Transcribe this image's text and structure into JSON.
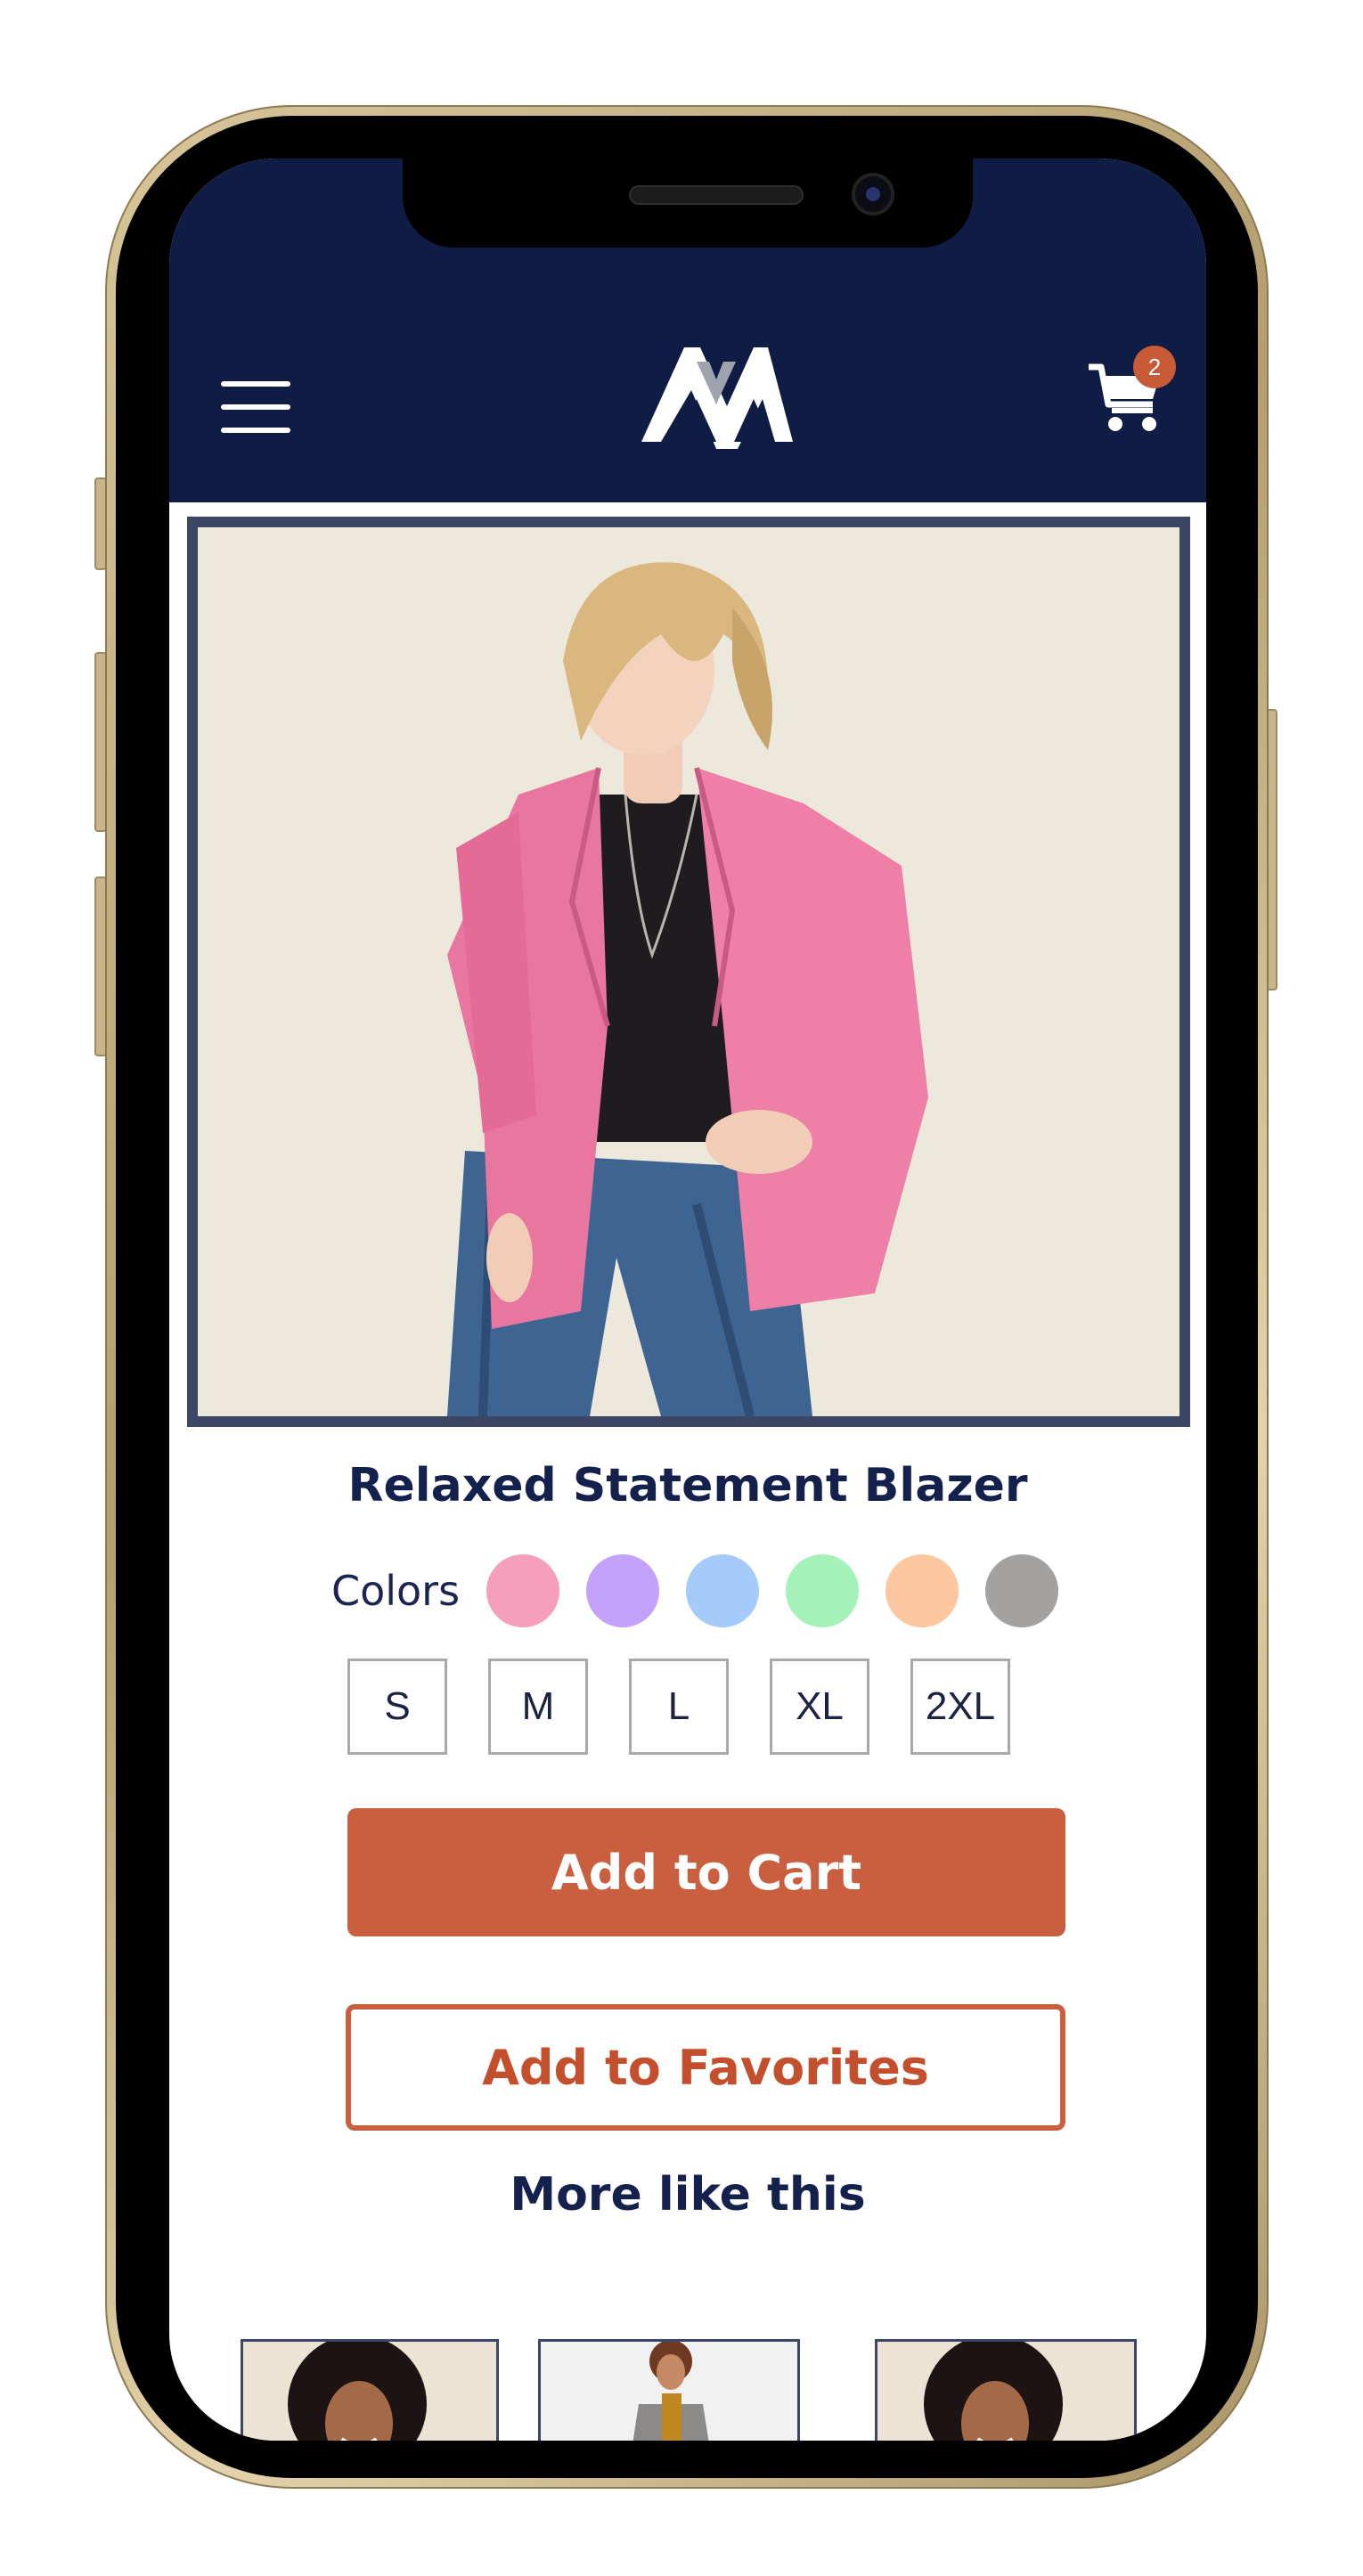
{
  "header": {
    "menu_icon": "hamburger-menu-icon",
    "logo": "brand-logo-m",
    "cart_icon": "shopping-cart-icon",
    "cart_count": "2"
  },
  "product": {
    "image": "woman-in-pink-blazer",
    "title": "Relaxed Statement Blazer",
    "colors_label": "Colors",
    "colors": [
      "#f69fbd",
      "#c2a2fb",
      "#a4cbf9",
      "#a4f2ba",
      "#fdc79f",
      "#a4a2a0"
    ],
    "sizes": [
      "S",
      "M",
      "L",
      "XL",
      "2XL"
    ]
  },
  "actions": {
    "add_to_cart": "Add to Cart",
    "add_to_favorites": "Add to Favorites"
  },
  "recommendations": {
    "title": "More like this",
    "items": [
      "curly-hair-woman",
      "woman-in-gray-blazer",
      "curly-hair-woman-smiling"
    ]
  },
  "colors": {
    "navy": "#0f1c44",
    "accent": "#c95f3f",
    "frame": "#3c4766"
  }
}
